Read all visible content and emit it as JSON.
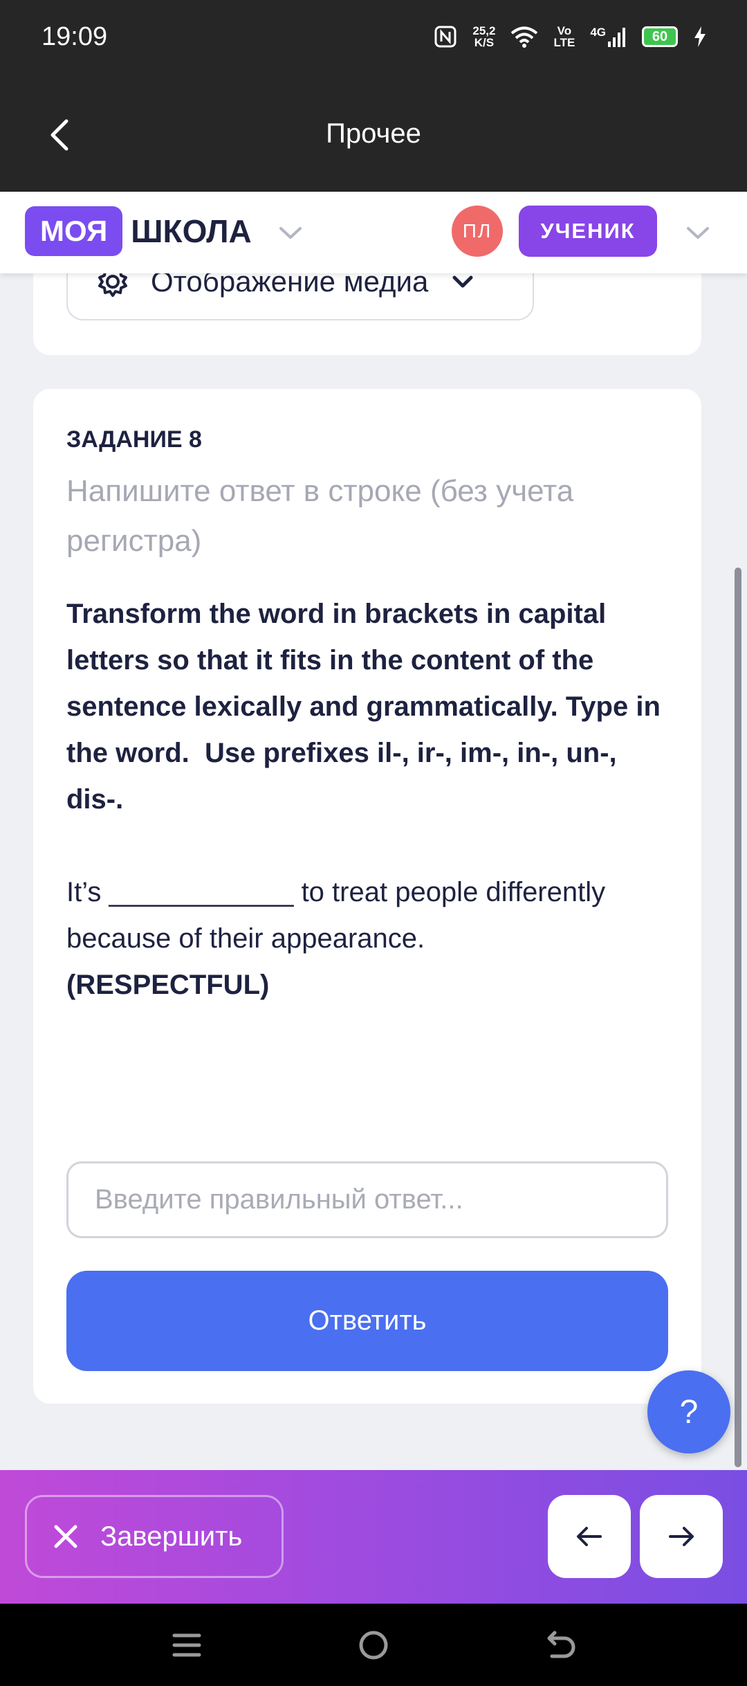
{
  "status": {
    "time": "19:09",
    "speed_value": "25,2",
    "speed_unit": "K/S",
    "volte_top": "Vo",
    "volte_bottom": "LTE",
    "network": "4G",
    "battery": "60"
  },
  "appbar": {
    "title": "Прочее"
  },
  "header": {
    "logo_part1": "МОЯ",
    "logo_part2": "ШКОЛА",
    "avatar_initials": "ПЛ",
    "role": "УЧЕНИК"
  },
  "media": {
    "label": "Отображение медиа"
  },
  "task": {
    "label": "ЗАДАНИЕ 8",
    "instruction": "Напишите ответ в строке (без учета регистра)",
    "bold_intro": "Transform the word in brackets in capital letters so that it fits in the content of the sentence lexically and grammatically. Type in the word.  Use prefixes il-, ir-, im-, in-, un-, dis-.",
    "sentence": "It’s ____________ to treat people differently because of their appearance.",
    "keyword": "(RESPECTFUL)"
  },
  "answer": {
    "placeholder": "Введите правильный ответ...",
    "value": ""
  },
  "buttons": {
    "submit": "Ответить",
    "help": "?",
    "finish": "Завершить"
  },
  "colors": {
    "accent": "#4a6ff0",
    "brand": "#7b4df0",
    "role": "#8845e8",
    "avatar": "#f06a6a"
  }
}
